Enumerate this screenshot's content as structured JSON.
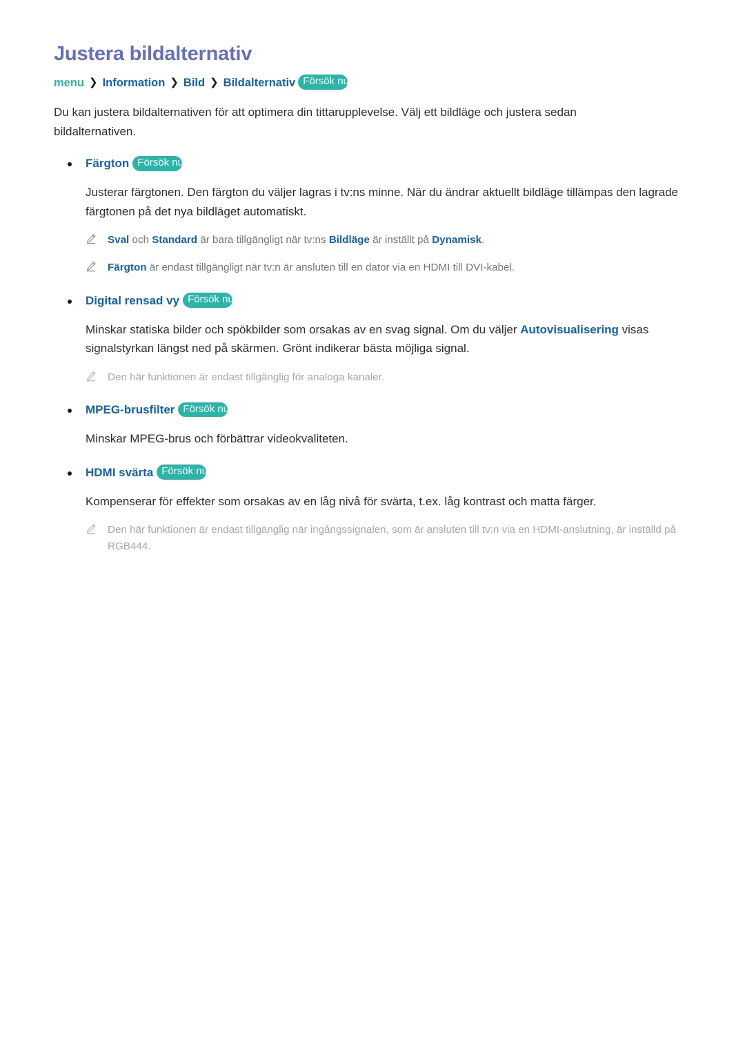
{
  "page": {
    "title": "Justera bildalternativ",
    "language": "sv"
  },
  "colors": {
    "title": "#6470be",
    "link_blue": "#1263ad",
    "teal_accent": "#2bb4a8",
    "body_text": "#2e2e2e",
    "note_dark": "#767676",
    "note_light": "#a8a8a8"
  },
  "breadcrumb": {
    "root": "menu",
    "separator": "❯",
    "items": [
      "Information",
      "Bild",
      "Bildalternativ"
    ],
    "badge": "Försök nu"
  },
  "intro": "Du kan justera bildalternativen för att optimera din tittarupplevelse. Välj ett bildläge och justera sedan bildalternativen.",
  "badge_label": "Försök nu",
  "options": [
    {
      "name": "Färgton",
      "badge": "Försök nu",
      "description": "Justerar färgtonen. Den färgton du väljer lagras i tv:ns minne. När du ändrar aktuellt bildläge tillämpas den lagrade färgtonen på det nya bildläget automatiskt.",
      "notes": [
        {
          "tone": "dark",
          "segments": [
            {
              "text": "Sval",
              "kw": true
            },
            {
              "text": " och ",
              "kw": false
            },
            {
              "text": "Standard",
              "kw": true
            },
            {
              "text": " är bara tillgängligt när tv:ns ",
              "kw": false
            },
            {
              "text": "Bildläge",
              "kw": true
            },
            {
              "text": " är inställt på ",
              "kw": false
            },
            {
              "text": "Dynamisk",
              "kw": true
            },
            {
              "text": ".",
              "kw": false
            }
          ]
        },
        {
          "tone": "dark",
          "segments": [
            {
              "text": "Färgton",
              "kw": true
            },
            {
              "text": " är endast tillgängligt när tv:n är ansluten till en dator via en HDMI till DVI-kabel.",
              "kw": false
            }
          ]
        }
      ]
    },
    {
      "name": "Digital rensad vy",
      "badge": "Försök nu",
      "description_segments": [
        {
          "text": "Minskar statiska bilder och spökbilder som orsakas av en svag signal. Om du väljer ",
          "kw": false
        },
        {
          "text": "Autovisualisering",
          "kw": true
        },
        {
          "text": " visas signalstyrkan längst ned på skärmen. Grönt indikerar bästa möjliga signal.",
          "kw": false
        }
      ],
      "notes": [
        {
          "tone": "light",
          "segments": [
            {
              "text": "Den här funktionen är endast tillgänglig för analoga kanaler.",
              "kw": false
            }
          ]
        }
      ]
    },
    {
      "name": "MPEG-brusfilter",
      "badge": "Försök nu",
      "description": "Minskar MPEG-brus och förbättrar videokvaliteten.",
      "notes": []
    },
    {
      "name": "HDMI svärta",
      "badge": "Försök nu",
      "description": "Kompenserar för effekter som orsakas av en låg nivå för svärta, t.ex. låg kontrast och matta färger.",
      "notes": [
        {
          "tone": "light",
          "segments": [
            {
              "text": "Den här funktionen är endast tillgänglig när ingångssignalen, som är ansluten till tv:n via en HDMI-anslutning, är inställd på RGB444.",
              "kw": false
            }
          ]
        }
      ]
    }
  ],
  "icons": {
    "note": "pencil-icon",
    "bullet": "bullet-dot-icon",
    "separator": "chevron-right-icon"
  }
}
